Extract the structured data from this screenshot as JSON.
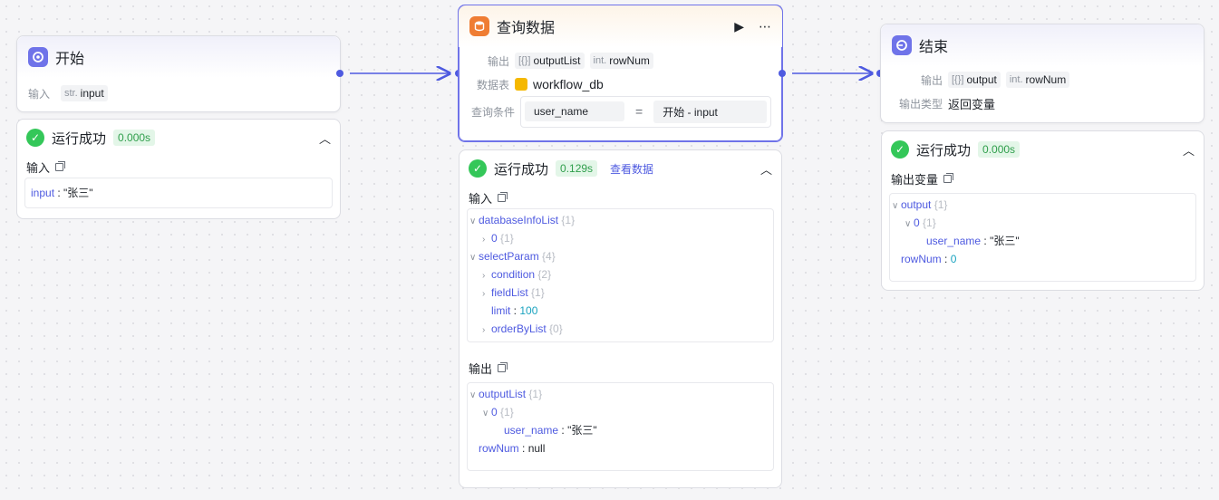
{
  "start_node": {
    "title": "开始",
    "input_label": "输入",
    "input_tag_prefix": "str.",
    "input_tag_name": "input",
    "result": {
      "status": "运行成功",
      "duration": "0.000s",
      "input_section": "输入",
      "key": "input",
      "value": "\"张三\""
    }
  },
  "query_node": {
    "title": "查询数据",
    "output_label": "输出",
    "output_tags": [
      {
        "prefix": "[{}]",
        "name": "outputList"
      },
      {
        "prefix": "int.",
        "name": "rowNum"
      }
    ],
    "table_label": "数据表",
    "table_name": "workflow_db",
    "condition_label": "查询条件",
    "condition_field": "user_name",
    "condition_op": "=",
    "condition_value": "开始  -  input",
    "result": {
      "status": "运行成功",
      "duration": "0.129s",
      "view_data": "查看数据",
      "input_section": "输入",
      "output_section": "输出",
      "input_tree": {
        "databaseInfoList": {
          "key": "databaseInfoList",
          "count": "{1}"
        },
        "db_0": {
          "key": "0",
          "count": "{1}"
        },
        "selectParam": {
          "key": "selectParam",
          "count": "{4}"
        },
        "condition": {
          "key": "condition",
          "count": "{2}"
        },
        "fieldList": {
          "key": "fieldList",
          "count": "{1}"
        },
        "limit": {
          "key": "limit",
          "value": "100"
        },
        "orderByList": {
          "key": "orderByList",
          "count": "{0}"
        }
      },
      "output_tree": {
        "outputList": {
          "key": "outputList",
          "count": "{1}"
        },
        "item0": {
          "key": "0",
          "count": "{1}"
        },
        "user_name": {
          "key": "user_name",
          "value": "\"张三\""
        },
        "rowNum": {
          "key": "rowNum",
          "value": "null"
        }
      }
    }
  },
  "end_node": {
    "title": "结束",
    "output_label": "输出",
    "output_tags": [
      {
        "prefix": "[{}]",
        "name": "output"
      },
      {
        "prefix": "int.",
        "name": "rowNum"
      }
    ],
    "output_type_label": "输出类型",
    "output_type_value": "返回变量",
    "result": {
      "status": "运行成功",
      "duration": "0.000s",
      "output_section": "输出变量",
      "tree": {
        "output": {
          "key": "output",
          "count": "{1}"
        },
        "item0": {
          "key": "0",
          "count": "{1}"
        },
        "user_name": {
          "key": "user_name",
          "value": "\"张三\""
        },
        "rowNum": {
          "key": "rowNum",
          "value": "0"
        }
      }
    }
  },
  "colors": {
    "accent": "#4e5ae0",
    "success": "#34c759",
    "start_icon": "#6f73e9",
    "query_icon": "#ef7d33"
  }
}
